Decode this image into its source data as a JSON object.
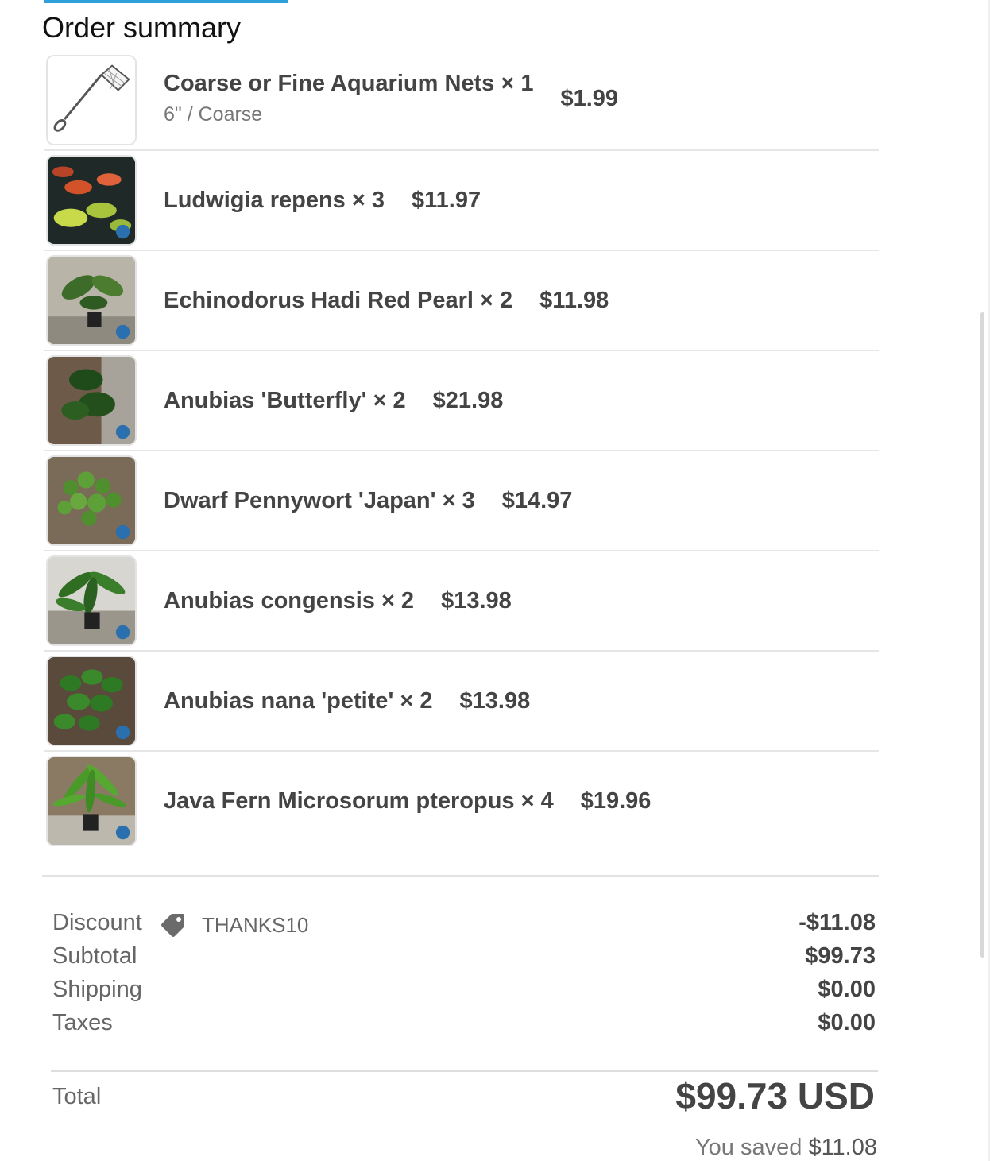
{
  "page": {
    "title": "Order summary"
  },
  "colors": {
    "accent": "#2ea1db",
    "text_primary": "#444444",
    "text_secondary": "#666666"
  },
  "items": [
    {
      "name": "Coarse or Fine Aquarium Nets × 1",
      "variant": "6\" / Coarse",
      "price": "$1.99",
      "thumbnail_icon": "aquarium-net-icon"
    },
    {
      "name": "Ludwigia repens × 3",
      "price": "$11.97",
      "thumbnail_icon": "plant-photo"
    },
    {
      "name": "Echinodorus Hadi Red Pearl × 2",
      "price": "$11.98",
      "thumbnail_icon": "plant-photo"
    },
    {
      "name": "Anubias 'Butterfly' × 2",
      "price": "$21.98",
      "thumbnail_icon": "plant-photo"
    },
    {
      "name": "Dwarf Pennywort 'Japan' × 3",
      "price": "$14.97",
      "thumbnail_icon": "plant-photo"
    },
    {
      "name": "Anubias congensis × 2",
      "price": "$13.98",
      "thumbnail_icon": "plant-photo"
    },
    {
      "name": "Anubias nana 'petite' × 2",
      "price": "$13.98",
      "thumbnail_icon": "plant-photo"
    },
    {
      "name": "Java Fern Microsorum pteropus × 4",
      "price": "$19.96",
      "thumbnail_icon": "plant-photo"
    }
  ],
  "summary": {
    "discount": {
      "label": "Discount",
      "code": "THANKS10",
      "value": "-$11.08",
      "icon": "tag-icon"
    },
    "subtotal": {
      "label": "Subtotal",
      "value": "$99.73"
    },
    "shipping": {
      "label": "Shipping",
      "value": "$0.00"
    },
    "taxes": {
      "label": "Taxes",
      "value": "$0.00"
    }
  },
  "total": {
    "label": "Total",
    "value": "$99.73 USD"
  },
  "savings": {
    "label": "You saved",
    "value": "$11.08"
  }
}
